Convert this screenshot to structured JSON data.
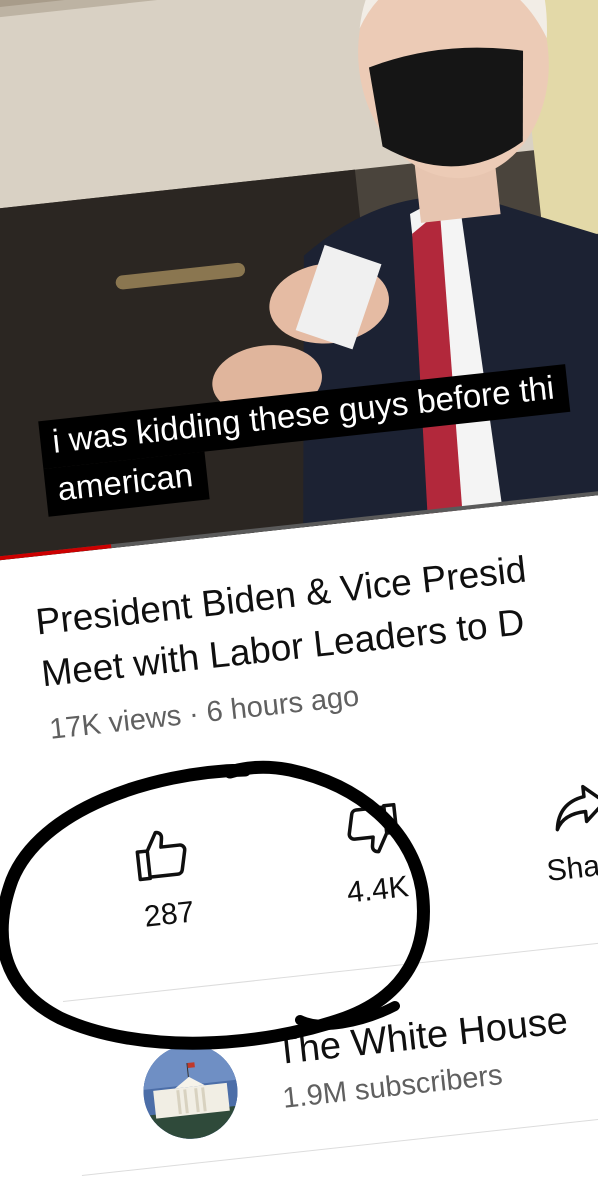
{
  "video": {
    "caption_lines": [
      "i was kidding these guys before thi",
      "american"
    ],
    "progress_fraction": 0.18
  },
  "title": {
    "line_1": "President Biden & Vice Presid",
    "line_2": "Meet with Labor Leaders to D"
  },
  "meta": {
    "text": "17K views · 6 hours ago"
  },
  "actions": {
    "like_count": "287",
    "dislike_count": "4.4K",
    "share_label": "Share"
  },
  "channel": {
    "name": "The White House",
    "subscribers": "1.9M subscribers"
  },
  "icons": {
    "like": "thumbs-up-icon",
    "dislike": "thumbs-down-icon",
    "share": "share-arrow-icon"
  },
  "colors": {
    "text_primary": "#0f0f0f",
    "text_secondary": "#606060",
    "caption_bg": "#000000",
    "progress": "#cc0000",
    "annotation_ink": "#000000"
  }
}
